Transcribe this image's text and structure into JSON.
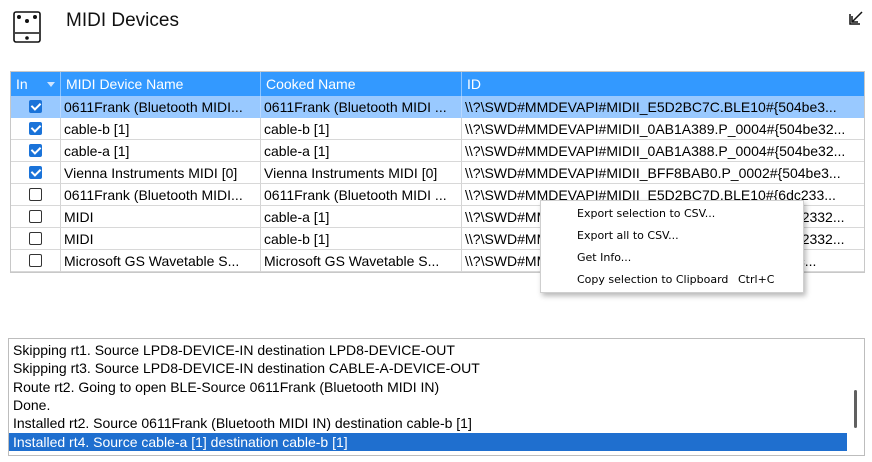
{
  "window": {
    "title": "MIDI Devices",
    "icon": "midi-pedal-icon",
    "restore_icon": "restore-down-icon"
  },
  "grid": {
    "columns": [
      "In",
      "MIDI Device Name",
      "Cooked Name",
      "ID"
    ],
    "rows": [
      {
        "checked": true,
        "name": "0611Frank (Bluetooth MIDI...",
        "cooked": "0611Frank (Bluetooth MIDI ...",
        "id": "\\\\?\\SWD#MMDEVAPI#MIDII_E5D2BC7C.BLE10#{504be3...",
        "selected": true
      },
      {
        "checked": true,
        "name": "cable-b [1]",
        "cooked": "cable-b [1]",
        "id": "\\\\?\\SWD#MMDEVAPI#MIDII_0AB1A389.P_0004#{504be32..."
      },
      {
        "checked": true,
        "name": "cable-a [1]",
        "cooked": "cable-a [1]",
        "id": "\\\\?\\SWD#MMDEVAPI#MIDII_0AB1A388.P_0004#{504be32..."
      },
      {
        "checked": true,
        "name": "Vienna Instruments MIDI [0]",
        "cooked": "Vienna Instruments MIDI [0]",
        "id": "\\\\?\\SWD#MMDEVAPI#MIDII_BFF8BAB0.P_0002#{504be3..."
      },
      {
        "checked": false,
        "name": "0611Frank (Bluetooth MIDI...",
        "cooked": "0611Frank (Bluetooth MIDI ...",
        "id": "\\\\?\\SWD#MMDEVAPI#MIDII_E5D2BC7D.BLE10#{6dc233..."
      },
      {
        "checked": false,
        "name": "MIDI",
        "cooked": "cable-a [1]",
        "id": "\\\\?\\SWD#MMDEVAPI#MIDII_0AB1A389.P_0004#{6dc2332..."
      },
      {
        "checked": false,
        "name": "MIDI",
        "cooked": "cable-b [1]",
        "id": "\\\\?\\SWD#MMDEVAPI#MIDII_0AB1A388.P_0004#{6dc2332..."
      },
      {
        "checked": false,
        "name": "Microsoft GS Wavetable S...",
        "cooked": "Microsoft GS Wavetable S...",
        "id": "\\\\?\\SWD#MMDEVAPI#MIDII_BFF8BAB0.P_0002#{6dc..."
      }
    ]
  },
  "context_menu": {
    "items": [
      {
        "label": "Export selection to CSV...",
        "shortcut": ""
      },
      {
        "label": "Export all to CSV...",
        "shortcut": ""
      },
      {
        "label": "Get Info...",
        "shortcut": ""
      },
      {
        "label": "Copy selection to Clipboard",
        "shortcut": "Ctrl+C"
      }
    ]
  },
  "log": {
    "lines": [
      "Skipping rt1. Source LPD8-DEVICE-IN destination LPD8-DEVICE-OUT",
      "Skipping rt3. Source LPD8-DEVICE-IN destination CABLE-A-DEVICE-OUT",
      "Route rt2. Going to open BLE-Source 0611Frank (Bluetooth MIDI IN)",
      "Done.",
      "Installed rt2. Source 0611Frank (Bluetooth MIDI IN) destination cable-b [1]",
      "Installed rt4. Source cable-a [1] destination cable-b [1]"
    ],
    "selected_index": 5
  },
  "colors": {
    "header_bg": "#3399ff",
    "row_selected": "#99c9ff",
    "log_selected": "#1f6fcf",
    "checkbox_on": "#1a73d9"
  }
}
